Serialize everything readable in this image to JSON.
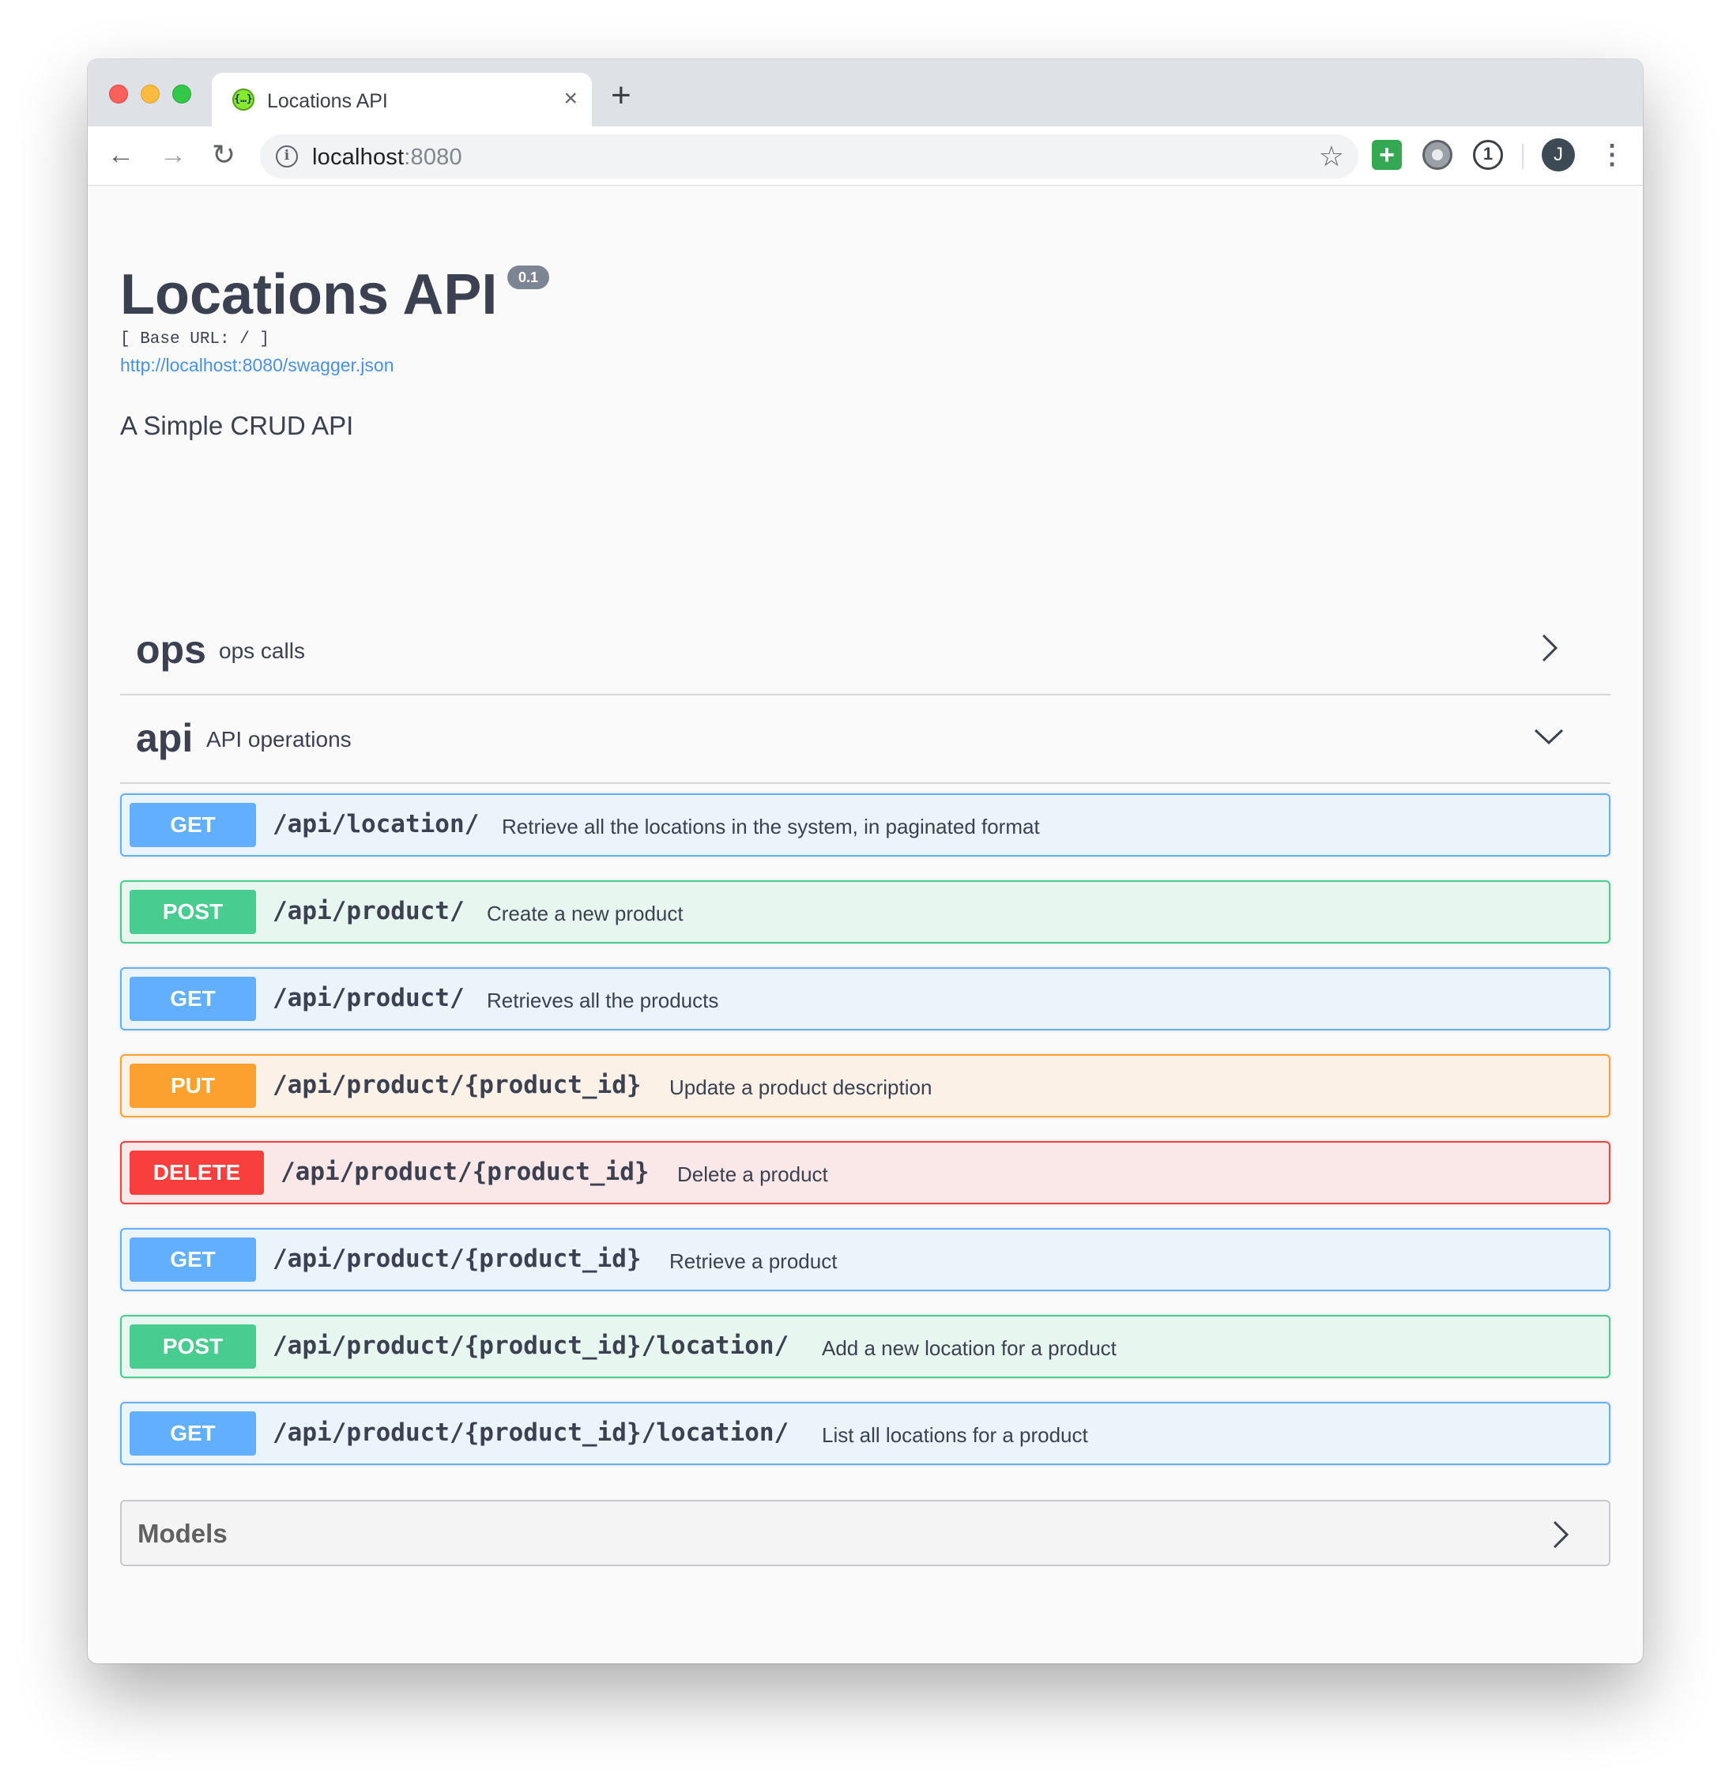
{
  "browser": {
    "tab_title": "Locations API",
    "tab_favicon_glyph": "{…}",
    "close_glyph": "×",
    "newtab_glyph": "+",
    "back_glyph": "←",
    "forward_glyph": "→",
    "reload_glyph": "↻",
    "info_glyph": "i",
    "url_host": "localhost",
    "url_port": ":8080",
    "star_glyph": "☆",
    "ext_plus_glyph": "+",
    "ext_pass_glyph": "1",
    "avatar_initial": "J",
    "menu_glyph": "⋮",
    "icons": [
      "back-arrow-icon",
      "forward-arrow-icon",
      "reload-icon",
      "info-icon",
      "star-icon",
      "extension-plus-icon",
      "extension-film-icon",
      "password-manager-icon",
      "profile-avatar",
      "more-menu-icon"
    ]
  },
  "info": {
    "title": "Locations API",
    "version": "0.1",
    "base_url": "[ Base URL: / ]",
    "spec_url": "http://localhost:8080/swagger.json",
    "description": "A Simple CRUD API"
  },
  "tags": [
    {
      "name": "ops",
      "description": "ops calls",
      "expanded": false
    },
    {
      "name": "api",
      "description": "API operations",
      "expanded": true
    }
  ],
  "operations": [
    {
      "method": "GET",
      "path": "/api/location/",
      "summary": "Retrieve all the locations in the system, in paginated format"
    },
    {
      "method": "POST",
      "path": "/api/product/",
      "summary": "Create a new product"
    },
    {
      "method": "GET",
      "path": "/api/product/",
      "summary": "Retrieves all the products"
    },
    {
      "method": "PUT",
      "path": "/api/product/{product_id}",
      "summary": "Update a product description"
    },
    {
      "method": "DELETE",
      "path": "/api/product/{product_id}",
      "summary": "Delete a product"
    },
    {
      "method": "GET",
      "path": "/api/product/{product_id}",
      "summary": "Retrieve a product"
    },
    {
      "method": "POST",
      "path": "/api/product/{product_id}/location/",
      "summary": "Add a new location for a product"
    },
    {
      "method": "GET",
      "path": "/api/product/{product_id}/location/",
      "summary": "List all locations for a product"
    }
  ],
  "models": {
    "label": "Models"
  },
  "colors": {
    "get": "#61affe",
    "post": "#49cc90",
    "put": "#fca130",
    "delete": "#f93e3e",
    "text": "#3b4151",
    "link": "#4990e2"
  }
}
